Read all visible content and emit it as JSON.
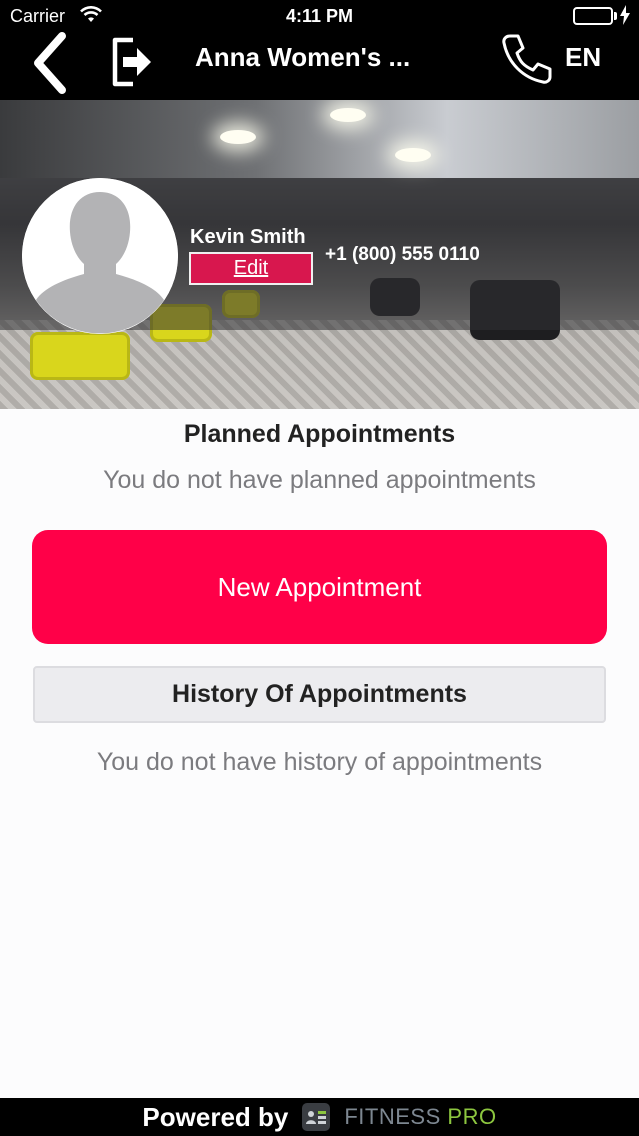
{
  "status_bar": {
    "carrier": "Carrier",
    "time": "4:11 PM",
    "battery_level": 1.0
  },
  "nav": {
    "title": "Anna Women's ...",
    "language": "EN",
    "back_icon": "chevron-left-icon",
    "logout_icon": "logout-icon",
    "phone_icon": "phone-icon"
  },
  "profile": {
    "name": "Kevin Smith",
    "edit_label": "Edit",
    "phone": "+1 (800) 555 0110"
  },
  "planned": {
    "title": "Planned Appointments",
    "empty_text": "You do not have planned appointments"
  },
  "new_appointment_label": "New Appointment",
  "history": {
    "title": "History Of Appointments",
    "empty_text": "You do not have history of appointments"
  },
  "footer": {
    "powered_by": "Powered by",
    "brand_part1": "FITNESS",
    "brand_part2": "PRO"
  },
  "colors": {
    "accent": "#ff0048",
    "edit_bg": "#d8174e",
    "nav_bg": "#000000",
    "brand_green": "#8cc63f"
  }
}
